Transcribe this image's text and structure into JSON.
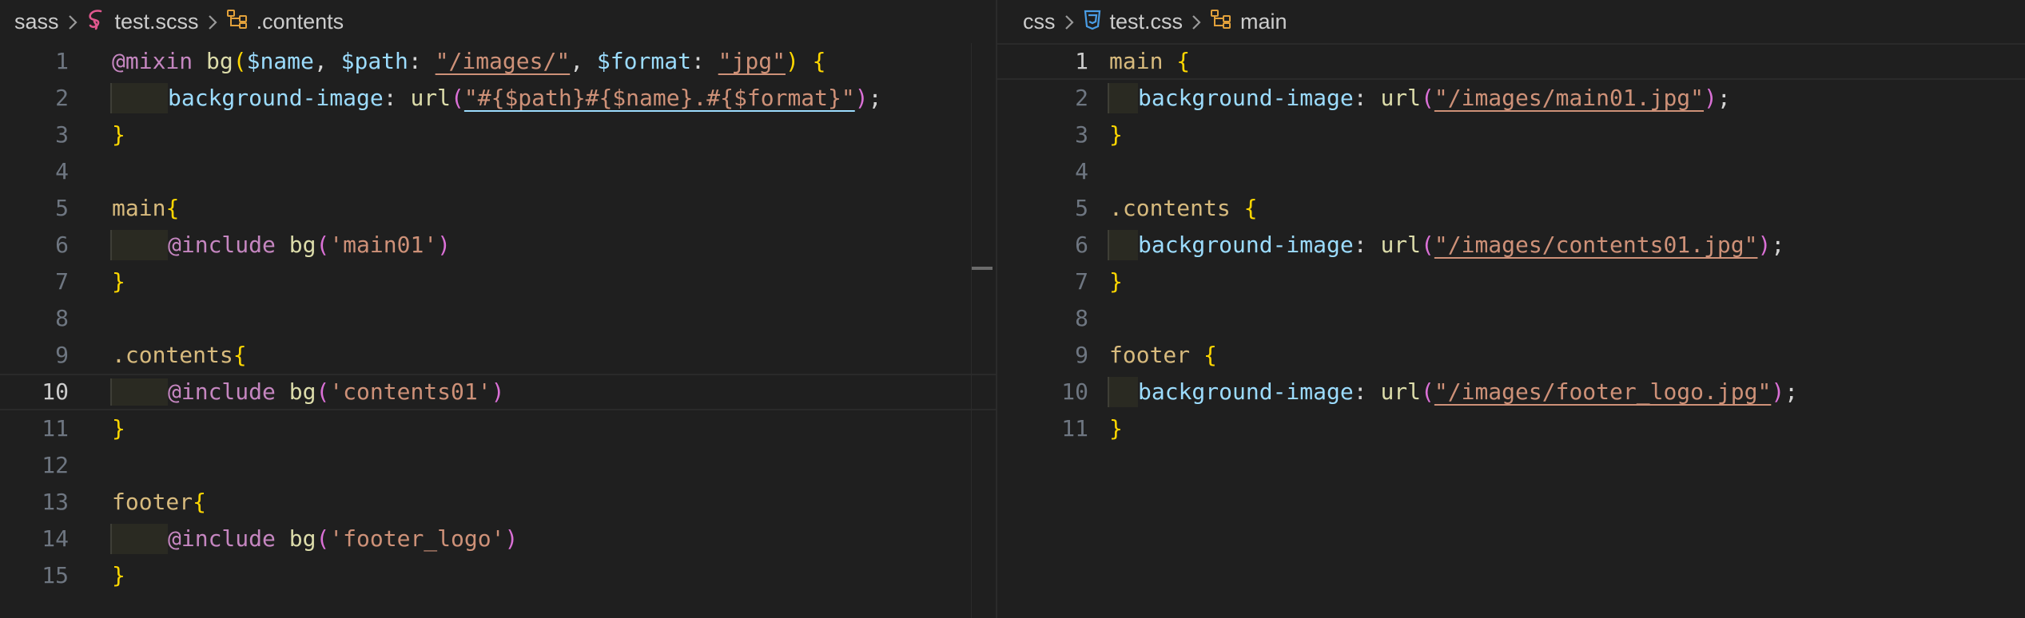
{
  "left": {
    "breadcrumb": {
      "folder": "sass",
      "file": "test.scss",
      "symbol": ".contents"
    },
    "active_line": 10,
    "lines": [
      {
        "n": "1",
        "tokens": [
          [
            "kw",
            "@mixin"
          ],
          [
            "plain",
            " "
          ],
          [
            "fn",
            "bg"
          ],
          [
            "brace",
            "("
          ],
          [
            "var",
            "$name"
          ],
          [
            "plain",
            ", "
          ],
          [
            "var",
            "$path"
          ],
          [
            "plain",
            ": "
          ],
          [
            "str",
            "\"/images/\""
          ],
          [
            "plain",
            ", "
          ],
          [
            "var",
            "$format"
          ],
          [
            "plain",
            ": "
          ],
          [
            "str",
            "\"jpg\""
          ],
          [
            "brace",
            ")"
          ],
          [
            "plain",
            " "
          ],
          [
            "brace",
            "{"
          ]
        ]
      },
      {
        "n": "2",
        "indent": true,
        "tokens": [
          [
            "prop",
            "background-image"
          ],
          [
            "plain",
            ": "
          ],
          [
            "fn",
            "url"
          ],
          [
            "paren",
            "("
          ],
          [
            "str",
            "\"#{$path}#{$name}.#{$format}\""
          ],
          [
            "paren",
            ")"
          ],
          [
            "plain",
            ";"
          ]
        ]
      },
      {
        "n": "3",
        "tokens": [
          [
            "brace",
            "}"
          ]
        ]
      },
      {
        "n": "4",
        "tokens": []
      },
      {
        "n": "5",
        "tokens": [
          [
            "sel",
            "main"
          ],
          [
            "brace",
            "{"
          ]
        ]
      },
      {
        "n": "6",
        "indent": true,
        "tokens": [
          [
            "kw",
            "@include"
          ],
          [
            "plain",
            " "
          ],
          [
            "fn",
            "bg"
          ],
          [
            "paren",
            "("
          ],
          [
            "str",
            "'main01'"
          ],
          [
            "paren",
            ")"
          ]
        ]
      },
      {
        "n": "7",
        "tokens": [
          [
            "brace",
            "}"
          ]
        ]
      },
      {
        "n": "8",
        "tokens": []
      },
      {
        "n": "9",
        "tokens": [
          [
            "sel",
            ".contents"
          ],
          [
            "brace",
            "{"
          ]
        ]
      },
      {
        "n": "10",
        "indent": true,
        "tokens": [
          [
            "kw",
            "@include"
          ],
          [
            "plain",
            " "
          ],
          [
            "fn",
            "bg"
          ],
          [
            "paren",
            "("
          ],
          [
            "str",
            "'contents01'"
          ],
          [
            "paren",
            ")"
          ]
        ]
      },
      {
        "n": "11",
        "tokens": [
          [
            "brace",
            "}"
          ]
        ]
      },
      {
        "n": "12",
        "tokens": []
      },
      {
        "n": "13",
        "tokens": [
          [
            "sel",
            "footer"
          ],
          [
            "brace",
            "{"
          ]
        ]
      },
      {
        "n": "14",
        "indent": true,
        "tokens": [
          [
            "kw",
            "@include"
          ],
          [
            "plain",
            " "
          ],
          [
            "fn",
            "bg"
          ],
          [
            "paren",
            "("
          ],
          [
            "str",
            "'footer_logo'"
          ],
          [
            "paren",
            ")"
          ]
        ]
      },
      {
        "n": "15",
        "tokens": [
          [
            "brace",
            "}"
          ]
        ]
      }
    ]
  },
  "right": {
    "breadcrumb": {
      "folder": "css",
      "file": "test.css",
      "symbol": "main"
    },
    "active_line": 1,
    "lines": [
      {
        "n": "1",
        "tokens": [
          [
            "sel",
            "main"
          ],
          [
            "plain",
            " "
          ],
          [
            "brace",
            "{"
          ]
        ]
      },
      {
        "n": "2",
        "indent": true,
        "tokens": [
          [
            "prop",
            "background-image"
          ],
          [
            "plain",
            ": "
          ],
          [
            "fn",
            "url"
          ],
          [
            "paren",
            "("
          ],
          [
            "str",
            "\"/images/main01.jpg\""
          ],
          [
            "paren",
            ")"
          ],
          [
            "plain",
            ";"
          ]
        ]
      },
      {
        "n": "3",
        "tokens": [
          [
            "brace",
            "}"
          ]
        ]
      },
      {
        "n": "4",
        "tokens": []
      },
      {
        "n": "5",
        "tokens": [
          [
            "sel",
            ".contents"
          ],
          [
            "plain",
            " "
          ],
          [
            "brace",
            "{"
          ]
        ]
      },
      {
        "n": "6",
        "indent": true,
        "tokens": [
          [
            "prop",
            "background-image"
          ],
          [
            "plain",
            ": "
          ],
          [
            "fn",
            "url"
          ],
          [
            "paren",
            "("
          ],
          [
            "str",
            "\"/images/contents01.jpg\""
          ],
          [
            "paren",
            ")"
          ],
          [
            "plain",
            ";"
          ]
        ]
      },
      {
        "n": "7",
        "tokens": [
          [
            "brace",
            "}"
          ]
        ]
      },
      {
        "n": "8",
        "tokens": []
      },
      {
        "n": "9",
        "tokens": [
          [
            "sel",
            "footer"
          ],
          [
            "plain",
            " "
          ],
          [
            "brace",
            "{"
          ]
        ]
      },
      {
        "n": "10",
        "indent": true,
        "tokens": [
          [
            "prop",
            "background-image"
          ],
          [
            "plain",
            ": "
          ],
          [
            "fn",
            "url"
          ],
          [
            "paren",
            "("
          ],
          [
            "str",
            "\"/images/footer_logo.jpg\""
          ],
          [
            "paren",
            ")"
          ],
          [
            "plain",
            ";"
          ]
        ]
      },
      {
        "n": "11",
        "tokens": [
          [
            "brace",
            "}"
          ]
        ]
      }
    ]
  },
  "colors": {
    "background": "#1f1f1f",
    "keyword": "#c586c0",
    "function": "#dcdcaa",
    "variable": "#9cdcfe",
    "string": "#ce9178",
    "brace": "#ffd700",
    "selector": "#d7ba7d"
  },
  "icons": {
    "sass_file": "sass-icon",
    "css_file": "css3-icon",
    "symbol": "symbol-class-icon",
    "separator": "chevron-right-icon"
  }
}
